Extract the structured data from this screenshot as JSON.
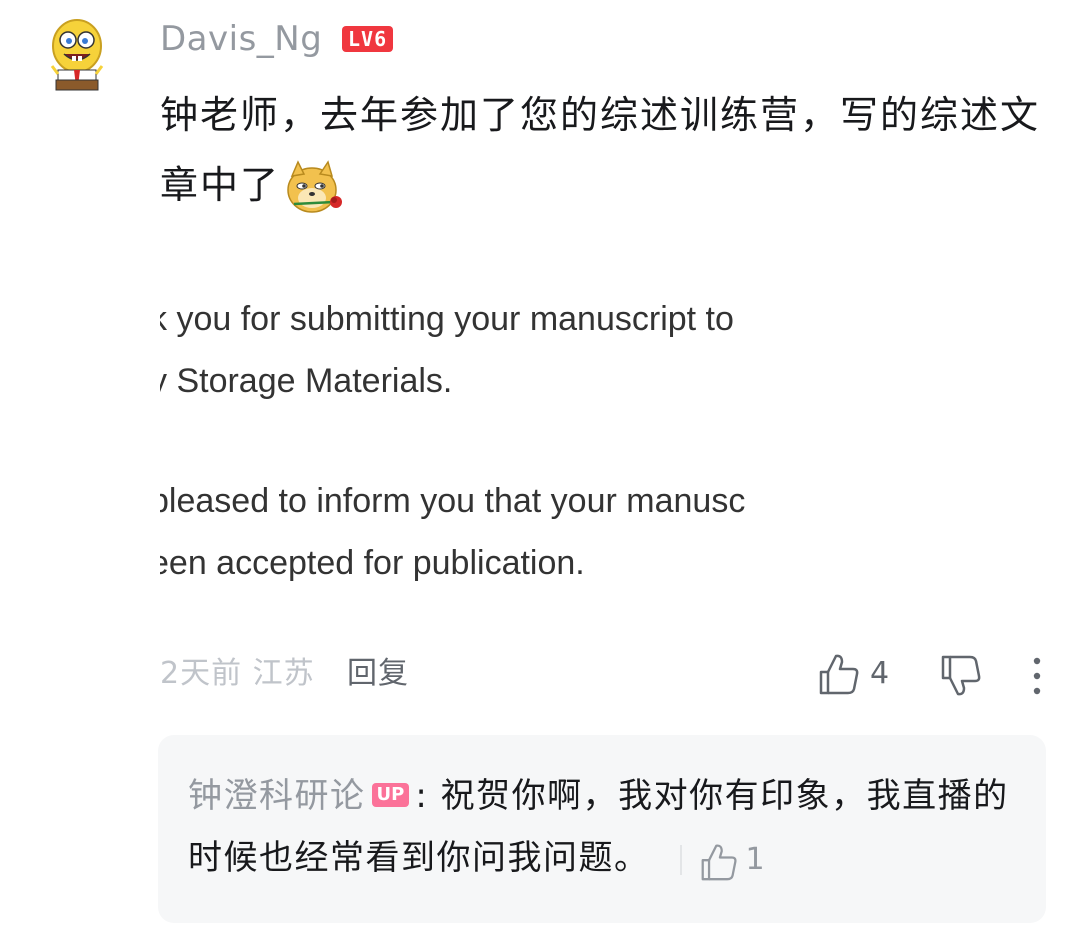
{
  "comment": {
    "username": "Davis_Ng",
    "level": "LV6",
    "text": "钟老师，去年参加了您的综述训练营，写的综述文章中了",
    "emoji": "doge-rose-emoji",
    "screenshot_lines": [
      "k you for submitting your manuscript to",
      "y Storage Materials.",
      "",
      "pleased to inform you that your manusc",
      "een accepted for publication."
    ],
    "time_location": "2天前 江苏",
    "reply_label": "回复",
    "like_count": "4"
  },
  "reply": {
    "author": "钟澄科研论",
    "badge": "UP",
    "separator": ":",
    "text": "祝贺你啊，我对你有印象，我直播的时候也经常看到你问我问题。",
    "like_count": "1"
  },
  "colors": {
    "level_badge": "#f0373f",
    "up_badge": "#fb7299",
    "muted_text": "#9499a0",
    "reply_bg": "#f6f7f8"
  }
}
